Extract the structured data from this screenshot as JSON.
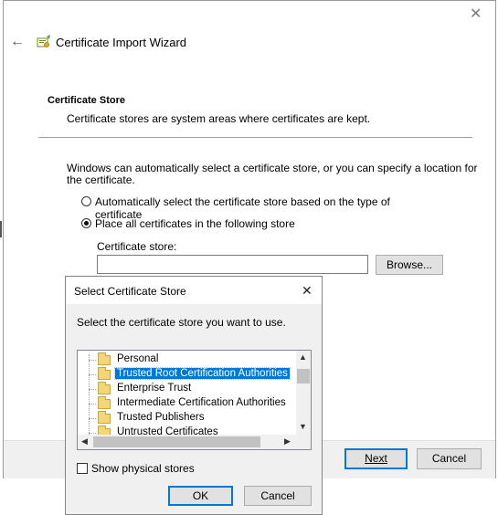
{
  "wizard": {
    "title": "Certificate Import Wizard",
    "section_title": "Certificate Store",
    "section_desc": "Certificate stores are system areas where certificates are kept.",
    "intro_line1": "Windows can automatically select a certificate store, or you can specify a location for",
    "intro_line2": "the certificate.",
    "option_auto": "Automatically select the certificate store based on the type of certificate",
    "option_place": "Place all certificates in the following store",
    "store_label": "Certificate store:",
    "store_value": "",
    "browse_label": "Browse...",
    "next_label": "Next",
    "cancel_label": "Cancel"
  },
  "dialog": {
    "title": "Select Certificate Store",
    "prompt": "Select the certificate store you want to use.",
    "stores": [
      "Personal",
      "Trusted Root Certification Authorities",
      "Enterprise Trust",
      "Intermediate Certification Authorities",
      "Trusted Publishers",
      "Untrusted Certificates"
    ],
    "selected_index": 1,
    "show_physical_label": "Show physical stores",
    "show_physical_checked": false,
    "ok_label": "OK",
    "cancel_label": "Cancel"
  },
  "colors": {
    "selection": "#0078d7",
    "dialog_bg": "#f0f0f0"
  }
}
